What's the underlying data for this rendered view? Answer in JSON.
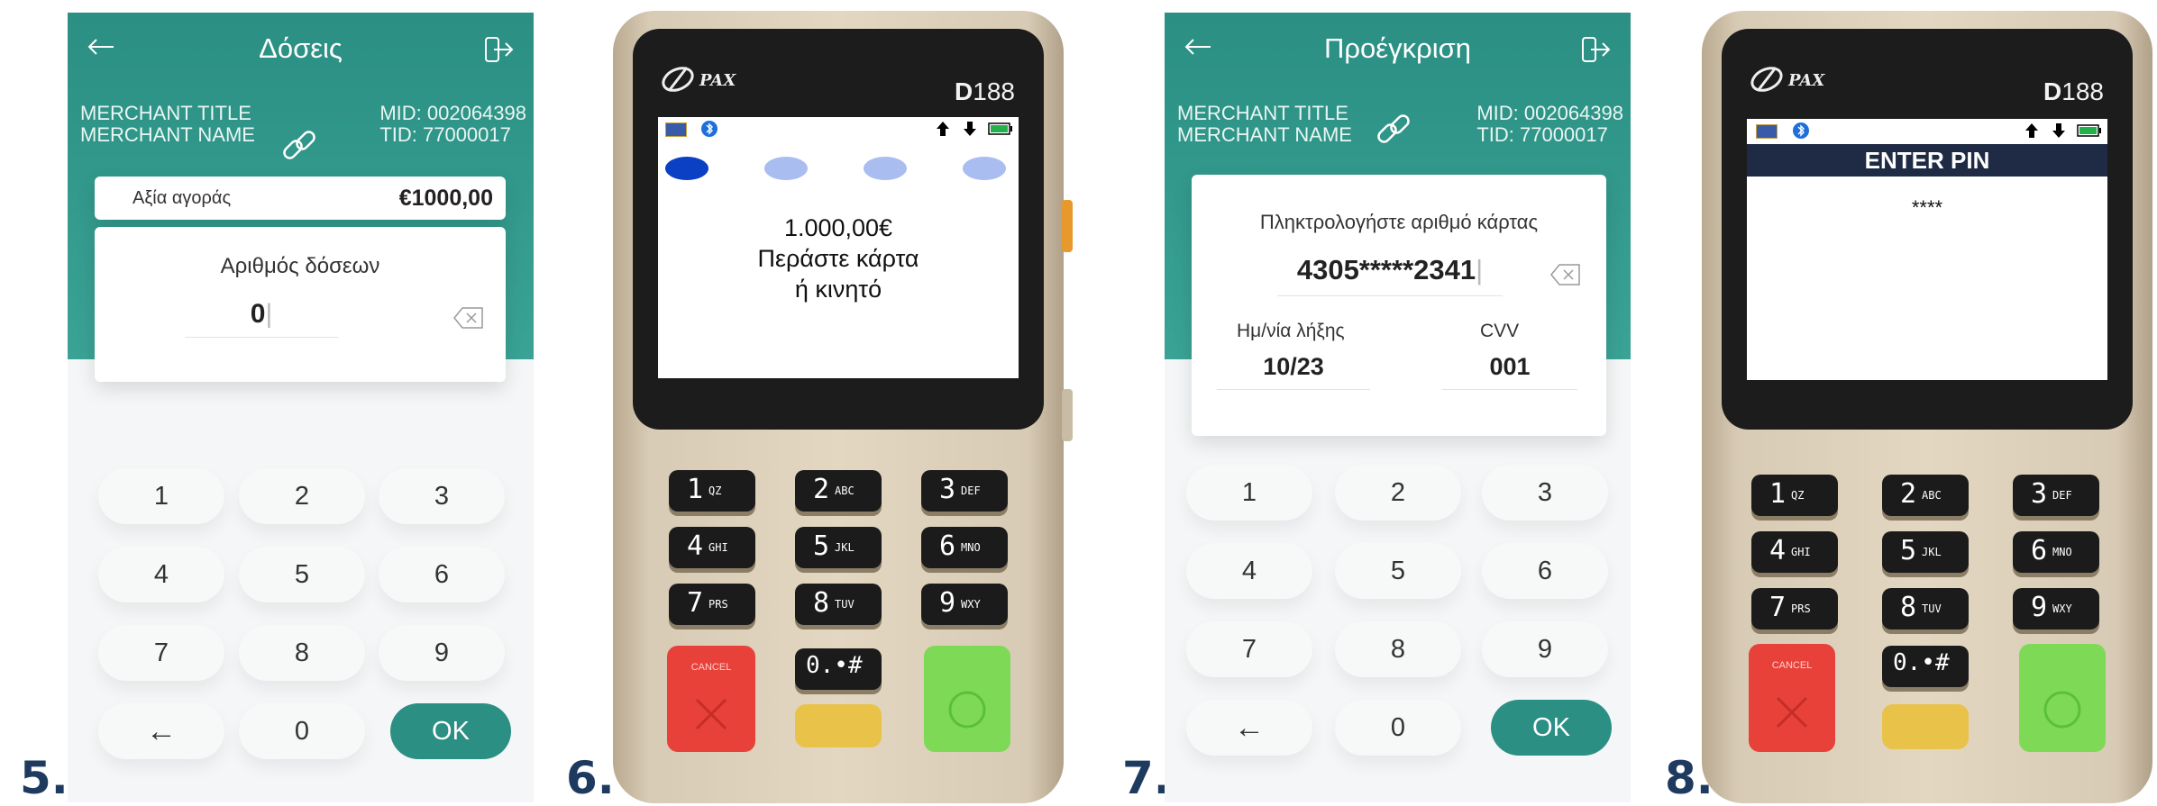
{
  "steps": {
    "s5": "5.",
    "s6": "6.",
    "s7": "7.",
    "s8": "8."
  },
  "panel5": {
    "title": "Δόσεις",
    "merchant_title": "MERCHANT TITLE",
    "merchant_name": "MERCHANT NAME",
    "mid": "MID: 002064398",
    "tid": "TID: 77000017",
    "amount_label": "Αξία αγοράς",
    "amount_value": "€1000,00",
    "installments_label": "Αριθμός δόσεων",
    "installments_value": "0",
    "keys": [
      "1",
      "2",
      "3",
      "4",
      "5",
      "6",
      "7",
      "8",
      "9",
      "←",
      "0",
      "OK"
    ]
  },
  "terminal6": {
    "brand": "PAX",
    "model_prefix": "D",
    "model_number": "188",
    "amount": "1.000,00€",
    "prompt_line1": "Περάστε κάρτα",
    "prompt_line2": "ή κινητό",
    "keys": [
      {
        "digit": "1",
        "letters": "QZ"
      },
      {
        "digit": "2",
        "letters": "ABC"
      },
      {
        "digit": "3",
        "letters": "DEF"
      },
      {
        "digit": "4",
        "letters": "GHI"
      },
      {
        "digit": "5",
        "letters": "JKL"
      },
      {
        "digit": "6",
        "letters": "MNO"
      },
      {
        "digit": "7",
        "letters": "PRS"
      },
      {
        "digit": "8",
        "letters": "TUV"
      },
      {
        "digit": "9",
        "letters": "WXY"
      }
    ],
    "zero_key": "0.•#",
    "cancel_label": "CANCEL"
  },
  "panel7": {
    "title": "Προέγκριση",
    "merchant_title": "MERCHANT TITLE",
    "merchant_name": "MERCHANT NAME",
    "mid": "MID: 002064398",
    "tid": "TID: 77000017",
    "card_prompt": "Πληκτρολογήστε αριθμό κάρτας",
    "card_number": "4305*****2341",
    "expiry_label": "Ημ/νία λήξης",
    "expiry_value": "10/23",
    "cvv_label": "CVV",
    "cvv_value": "001",
    "keys": [
      "1",
      "2",
      "3",
      "4",
      "5",
      "6",
      "7",
      "8",
      "9",
      "←",
      "0",
      "OK"
    ]
  },
  "terminal8": {
    "brand": "PAX",
    "model_prefix": "D",
    "model_number": "188",
    "pin_header": "ENTER PIN",
    "pin_mask": "****",
    "keys": [
      {
        "digit": "1",
        "letters": "QZ"
      },
      {
        "digit": "2",
        "letters": "ABC"
      },
      {
        "digit": "3",
        "letters": "DEF"
      },
      {
        "digit": "4",
        "letters": "GHI"
      },
      {
        "digit": "5",
        "letters": "JKL"
      },
      {
        "digit": "6",
        "letters": "MNO"
      },
      {
        "digit": "7",
        "letters": "PRS"
      },
      {
        "digit": "8",
        "letters": "TUV"
      },
      {
        "digit": "9",
        "letters": "WXY"
      }
    ],
    "zero_key": "0.•#",
    "cancel_label": "CANCEL"
  },
  "colors": {
    "teal": "#2b8f83",
    "step_label": "#1f3a5f",
    "pin_bar": "#1f2a44"
  }
}
